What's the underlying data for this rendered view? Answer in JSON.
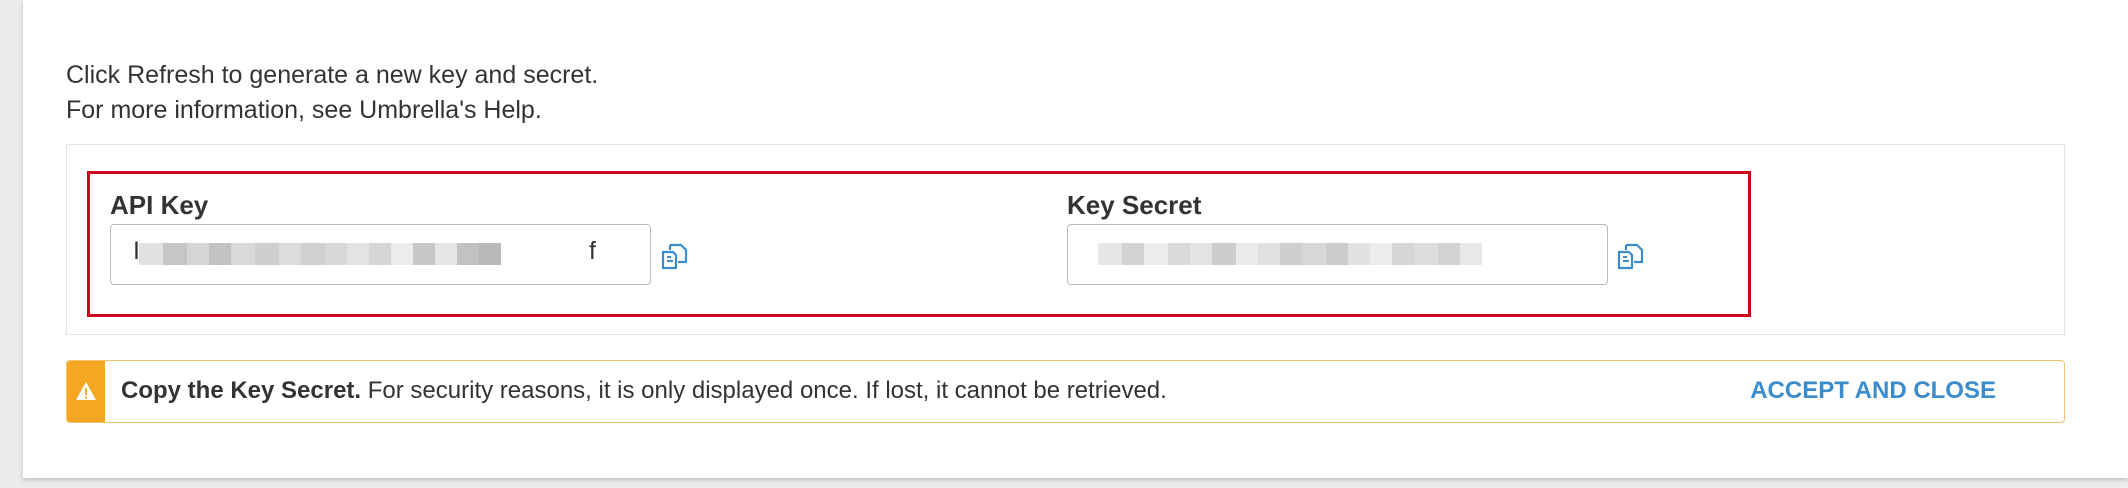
{
  "info": {
    "line1": "Click Refresh to generate a new key and secret.",
    "line2": "For more information, see Umbrella's Help."
  },
  "api_key": {
    "label": "API Key",
    "value_visible_prefix": "I",
    "value_visible_suffix": "f",
    "value_redacted": true
  },
  "key_secret": {
    "label": "Key Secret",
    "value_redacted": true
  },
  "alert": {
    "bold_text": "Copy the Key Secret.",
    "text": " For security reasons, it is only displayed once. If lost, it cannot be retrieved.",
    "action_label": "ACCEPT AND CLOSE",
    "icon": "warning-icon"
  },
  "icons": {
    "copy": "copy-icon",
    "warning": "warning-icon"
  },
  "colors": {
    "highlight_border": "#d0021b",
    "link_blue": "#3a8ccc",
    "warning_orange": "#f5a623",
    "warning_border": "#f0c36d"
  }
}
